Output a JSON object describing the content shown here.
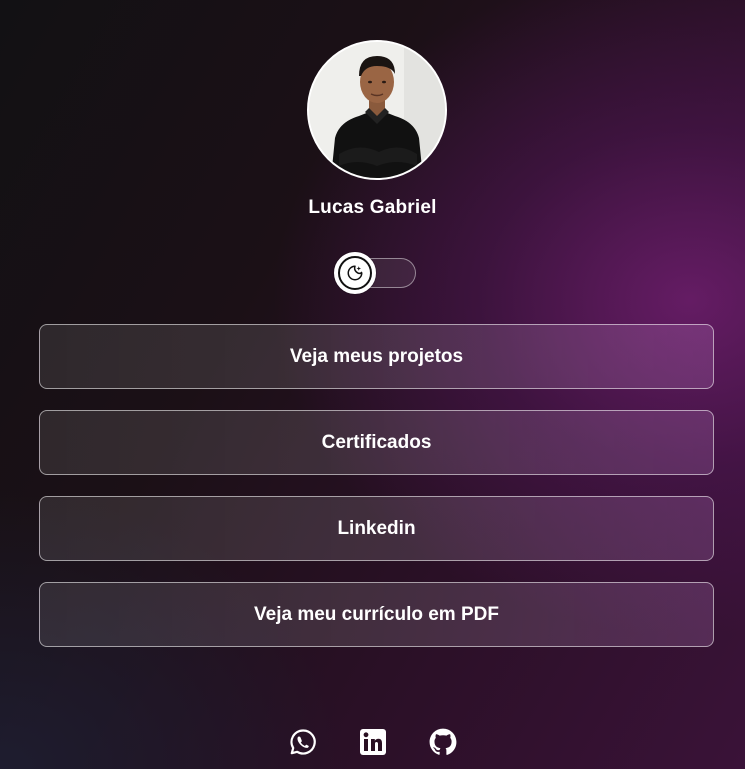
{
  "profile": {
    "name": "Lucas Gabriel",
    "avatar_icon": "profile-photo"
  },
  "theme_toggle": {
    "icon": "moon-stars-icon",
    "state": "dark"
  },
  "links": [
    {
      "label": "Veja meus projetos"
    },
    {
      "label": "Certificados"
    },
    {
      "label": "Linkedin"
    },
    {
      "label": "Veja meu currículo em PDF"
    }
  ],
  "socials": [
    {
      "icon": "whatsapp-icon"
    },
    {
      "icon": "linkedin-icon"
    },
    {
      "icon": "github-icon"
    }
  ],
  "colors": {
    "background_dark": "#121114",
    "background_accent": "#6e1e6e",
    "text": "#ffffff"
  }
}
